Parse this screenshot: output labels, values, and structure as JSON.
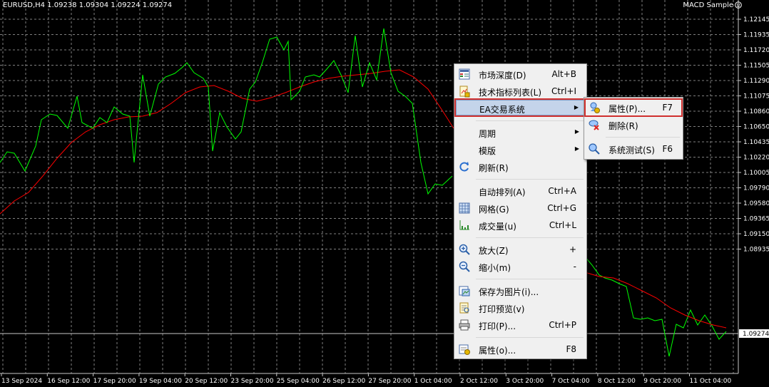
{
  "header": {
    "symbol_info": "EURUSD,H4  1.09238 1.09304 1.09224 1.09274",
    "expert_label": "MACD Sample"
  },
  "price_axis": {
    "labels": [
      "1.12145",
      "1.11935",
      "1.11720",
      "1.11505",
      "1.11290",
      "1.11075",
      "1.10860",
      "1.10650",
      "1.10435",
      "1.10220",
      "1.10005",
      "1.09790",
      "1.09580",
      "1.09365",
      "1.09150",
      "1.08935"
    ],
    "current_price": "1.09274"
  },
  "time_axis": {
    "labels": [
      "13 Sep 2024",
      "16 Sep 12:00",
      "17 Sep 20:00",
      "19 Sep 04:00",
      "20 Sep 12:00",
      "23 Sep 20:00",
      "25 Sep 04:00",
      "26 Sep 12:00",
      "27 Sep 20:00",
      "1 Oct 04:00",
      "2 Oct 12:00",
      "3 Oct 20:00",
      "7 Oct 04:00",
      "8 Oct 12:00",
      "9 Oct 20:00",
      "11 Oct 04:00"
    ]
  },
  "colors": {
    "background": "#000000",
    "grid": "#7f7f7f",
    "price_line": "#00ff00",
    "moving_average": "#ff0000",
    "highlight": "#d0302e"
  },
  "context_menu": {
    "items": [
      {
        "label": "市场深度(D)",
        "shortcut": "Alt+B",
        "icon": "market-depth-icon"
      },
      {
        "label": "技术指标列表(L)",
        "shortcut": "Ctrl+I",
        "icon": "indicators-list-icon"
      },
      {
        "label": "EA交易系统",
        "shortcut": "",
        "icon": "",
        "submenu": true,
        "selected": true
      },
      {
        "label": "周期",
        "shortcut": "",
        "icon": "",
        "submenu": true
      },
      {
        "label": "模版",
        "shortcut": "",
        "icon": "",
        "submenu": true
      },
      {
        "label": "刷新(R)",
        "shortcut": "",
        "icon": "refresh-icon"
      },
      {
        "label": "自动排列(A)",
        "shortcut": "Ctrl+A",
        "icon": ""
      },
      {
        "label": "网格(G)",
        "shortcut": "Ctrl+G",
        "icon": "grid-icon"
      },
      {
        "label": "成交量(u)",
        "shortcut": "Ctrl+L",
        "icon": "volumes-icon"
      },
      {
        "label": "放大(Z)",
        "shortcut": "+",
        "icon": "zoom-in-icon"
      },
      {
        "label": "缩小(m)",
        "shortcut": "-",
        "icon": "zoom-out-icon"
      },
      {
        "label": "保存为图片(i)...",
        "shortcut": "",
        "icon": "save-picture-icon"
      },
      {
        "label": "打印预览(v)",
        "shortcut": "",
        "icon": "print-preview-icon"
      },
      {
        "label": "打印(P)...",
        "shortcut": "Ctrl+P",
        "icon": "print-icon"
      },
      {
        "label": "属性(o)...",
        "shortcut": "F8",
        "icon": "properties-icon"
      }
    ]
  },
  "ea_submenu": {
    "items": [
      {
        "label": "属性(P)...",
        "shortcut": "F7",
        "icon": "ea-properties-icon"
      },
      {
        "label": "删除(R)",
        "shortcut": "",
        "icon": "ea-remove-icon"
      },
      {
        "label": "系统测试(S)",
        "shortcut": "F6",
        "icon": "strategy-tester-icon"
      }
    ]
  }
}
